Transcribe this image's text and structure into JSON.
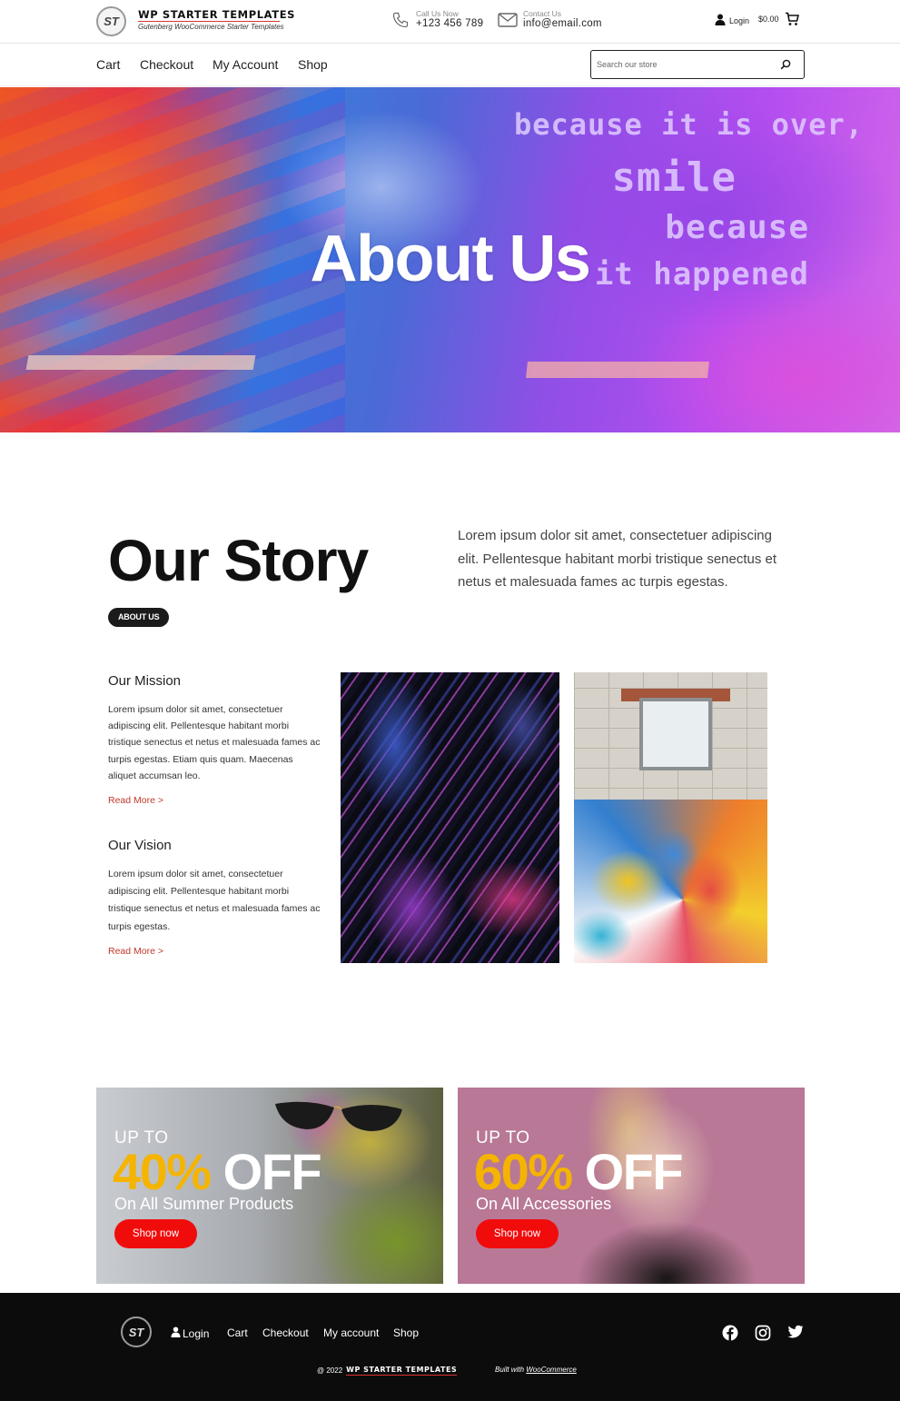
{
  "header": {
    "brand_title": "WP STARTER TEMPLATES",
    "brand_tagline": "Gutenberg WooCommerce Starter Templates",
    "logo_text": "ST",
    "phone_label": "Call Us Now",
    "phone_value": "+123 456 789",
    "email_label": "Contact Us",
    "email_value": "info@email.com",
    "login_label": "Login",
    "cart_total": "$0.00"
  },
  "nav": {
    "items": [
      "Cart",
      "Checkout",
      "My Account",
      "Shop"
    ],
    "search_placeholder": "Search our store"
  },
  "hero": {
    "title": "About Us",
    "wall_text": [
      "because it is over,",
      "smile",
      "because",
      "it happened"
    ]
  },
  "story": {
    "title": "Our Story",
    "badge": "ABOUT US",
    "intro": "Lorem ipsum dolor sit amet, consectetuer adipiscing elit. Pellentesque habitant morbi tristique senectus et netus et malesuada fames ac turpis egestas.",
    "mission_title": "Our Mission",
    "mission_text": "Lorem ipsum dolor sit amet, consectetuer adipiscing elit. Pellentesque habitant morbi tristique senectus et netus et malesuada fames ac turpis egestas. Etiam quis quam. Maecenas aliquet accumsan leo.",
    "mission_link": "Read More >",
    "vision_title": "Our Vision",
    "vision_text": "Lorem ipsum dolor sit amet, consectetuer adipiscing elit. Pellentesque habitant morbi tristique senectus et netus et malesuada fames ac turpis egestas.",
    "vision_link": "Read More >"
  },
  "promos": [
    {
      "upto": "UP TO",
      "percent": "40%",
      "off": "OFF",
      "subtitle": "On All Summer Products",
      "button": "Shop now"
    },
    {
      "upto": "UP TO",
      "percent": "60%",
      "off": "OFF",
      "subtitle": "On All Accessories",
      "button": "Shop now"
    }
  ],
  "footer": {
    "logo_text": "ST",
    "login": "Login",
    "nav": [
      "Cart",
      "Checkout",
      "My account",
      "Shop"
    ],
    "copyright": "@ 2022",
    "brand": "WP STARTER TEMPLATES",
    "built_prefix": "Built with",
    "built_link": "WooCommerce",
    "social_icons": [
      "facebook-icon",
      "instagram-icon",
      "twitter-icon"
    ]
  },
  "colors": {
    "accent_red": "#f10c0c",
    "promo_yellow": "#f4b400",
    "read_more": "#c0392b",
    "footer_bg": "#0c0c0c"
  }
}
